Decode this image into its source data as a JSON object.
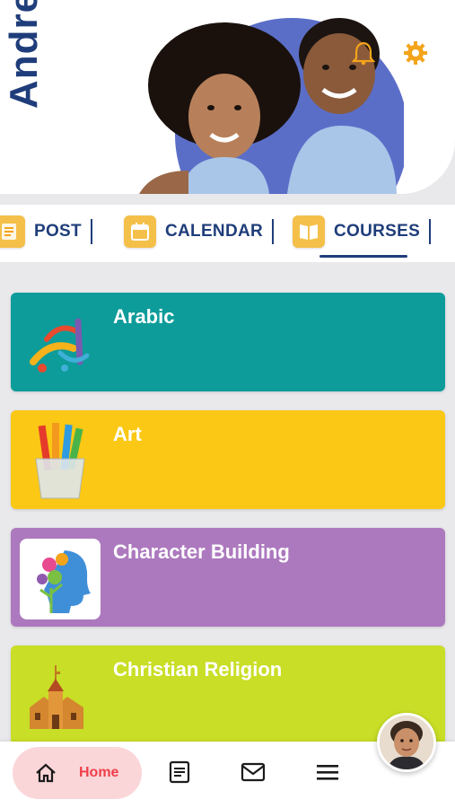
{
  "brand": {
    "text_main": "Andre",
    "accent_color": "#f4a41a",
    "brand_color": "#1f3d7a"
  },
  "header": {
    "hero_alt": "Two smiling children",
    "bell_icon": "bell-icon",
    "gear_icon": "gear-icon"
  },
  "tabs": [
    {
      "label": "POST",
      "icon": "post-icon"
    },
    {
      "label": "CALENDAR",
      "icon": "calendar-icon"
    },
    {
      "label": "COURSES",
      "icon": "book-icon",
      "active": true
    }
  ],
  "courses": [
    {
      "title": "Arabic",
      "color": "#0d9c9a",
      "icon": "arabic-letters-icon"
    },
    {
      "title": "Art",
      "color": "#fbc815",
      "icon": "colored-pencils-icon"
    },
    {
      "title": "Character Building",
      "color": "#ac79be",
      "icon": "head-flowers-icon"
    },
    {
      "title": "Christian Religion",
      "color": "#c9de26",
      "icon": "church-icon"
    }
  ],
  "bottom_nav": {
    "home_label": "Home",
    "home_color": "#ef3f4a",
    "items": [
      "home-icon",
      "posts-icon",
      "mail-icon",
      "menu-icon"
    ]
  }
}
